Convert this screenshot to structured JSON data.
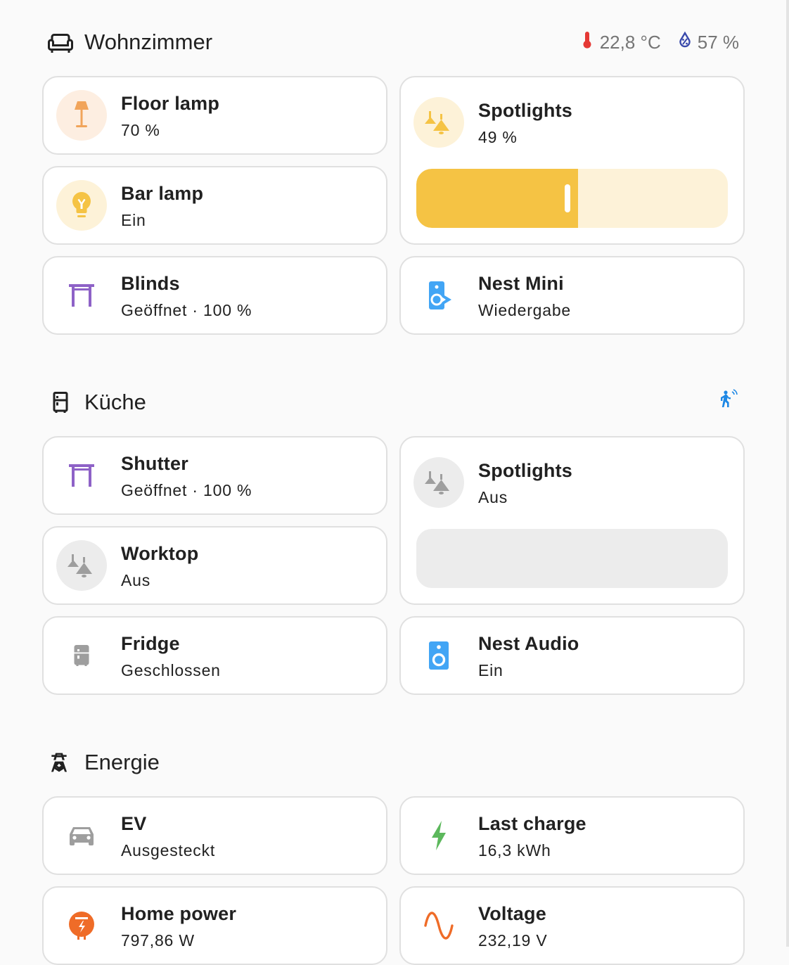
{
  "colors": {
    "light_orange": "#f1a45a",
    "light_orange_bg": "#fdeee1",
    "light_yellow": "#f5c344",
    "light_yellow_bg": "#fdf2d8",
    "cover_purple": "#8e62c7",
    "media_blue": "#42a5f5",
    "off_gray": "#9e9e9e",
    "off_gray_bg": "#ececec",
    "energy_green": "#5cb85c",
    "energy_orange": "#ef6c28",
    "temp_red": "#e53935",
    "humidity_blue": "#3949ab",
    "motion_blue": "#1e88e5"
  },
  "sections": [
    {
      "title": "Wohnzimmer",
      "icon": "sofa-icon",
      "badges": {
        "temperature": "22,8 °C",
        "humidity": "57 %"
      },
      "cards": {
        "floor_lamp": {
          "name": "Floor lamp",
          "state": "70 %",
          "icon": "floor-lamp-icon"
        },
        "bar_lamp": {
          "name": "Bar lamp",
          "state": "Ein",
          "icon": "lightbulb-icon"
        },
        "blinds": {
          "name": "Blinds",
          "state": "Geöffnet · 100 %",
          "icon": "blinds-icon"
        },
        "spotlights": {
          "name": "Spotlights",
          "state": "49 %",
          "icon": "spotlights-icon",
          "brightness": 0.49
        },
        "nest_mini": {
          "name": "Nest Mini",
          "state": "Wiedergabe",
          "icon": "speaker-play-icon"
        }
      }
    },
    {
      "title": "Küche",
      "icon": "fridge-icon",
      "badges": {
        "motion": "motion-icon"
      },
      "cards": {
        "shutter": {
          "name": "Shutter",
          "state": "Geöffnet · 100 %",
          "icon": "blinds-icon"
        },
        "worktop": {
          "name": "Worktop",
          "state": "Aus",
          "icon": "spotlights-icon"
        },
        "fridge": {
          "name": "Fridge",
          "state": "Geschlossen",
          "icon": "fridge-icon"
        },
        "spotlights": {
          "name": "Spotlights",
          "state": "Aus",
          "icon": "spotlights-icon",
          "brightness": 0
        },
        "nest_audio": {
          "name": "Nest Audio",
          "state": "Ein",
          "icon": "speaker-icon"
        }
      }
    },
    {
      "title": "Energie",
      "icon": "transmission-tower-icon",
      "cards": {
        "ev": {
          "name": "EV",
          "state": "Ausgesteckt",
          "icon": "car-icon"
        },
        "last_charge": {
          "name": "Last charge",
          "state": "16,3 kWh",
          "icon": "lightning-icon"
        },
        "home_power": {
          "name": "Home power",
          "state": "797,86 W",
          "icon": "home-power-icon"
        },
        "voltage": {
          "name": "Voltage",
          "state": "232,19 V",
          "icon": "sine-wave-icon"
        }
      }
    }
  ]
}
